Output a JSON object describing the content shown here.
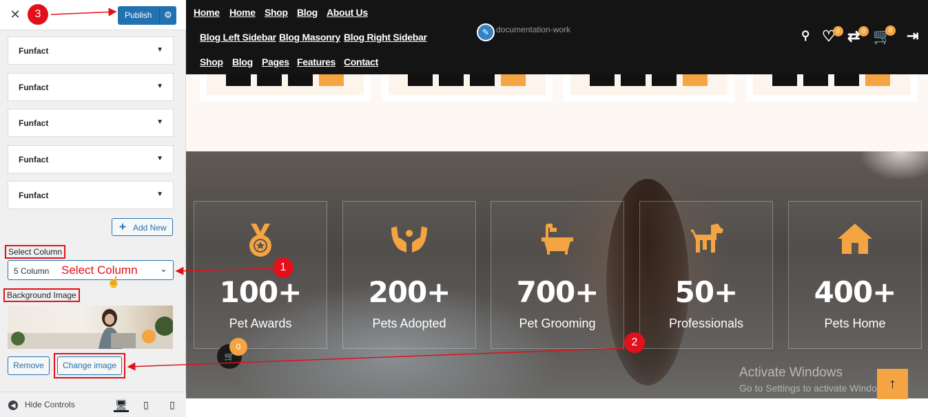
{
  "customizer": {
    "close_icon": "close-icon",
    "publish_label": "Publish",
    "funfacts": [
      "Funfact",
      "Funfact",
      "Funfact",
      "Funfact",
      "Funfact"
    ],
    "add_new_label": "Add New",
    "select_column_label": "Select Column",
    "select_column_value": "5 Column",
    "select_column_annotation": "Select Column",
    "background_image_label": "Background Image",
    "remove_label": "Remove",
    "change_image_label": "Change image",
    "hide_controls_label": "Hide Controls"
  },
  "annotations": {
    "step1": "1",
    "step2": "2",
    "step3": "3"
  },
  "header": {
    "nav_row1": [
      "Home",
      "Home",
      "Shop",
      "Blog",
      "About Us"
    ],
    "nav_row2": [
      "Blog Left Sidebar",
      "Blog Masonry",
      "Blog Right Sidebar"
    ],
    "nav_row3": [
      "Shop",
      "Blog",
      "Pages",
      "Features",
      "Contact"
    ],
    "logo_alt": "documentation-work",
    "wishlist_count": "0",
    "compare_count": "0",
    "cart_count": "0"
  },
  "stats": [
    {
      "number": "100+",
      "label": "Pet Awards",
      "icon": "medal-icon"
    },
    {
      "number": "200+",
      "label": "Pets Adopted",
      "icon": "caring-hands-icon"
    },
    {
      "number": "700+",
      "label": "Pet Grooming",
      "icon": "bathtub-icon"
    },
    {
      "number": "50+",
      "label": "Professionals",
      "icon": "dog-icon"
    },
    {
      "number": "400+",
      "label": "Pets Home",
      "icon": "home-icon"
    }
  ],
  "floating_cart_count": "0",
  "windows_watermark": {
    "title": "Activate Windows",
    "subtitle": "Go to Settings to activate Windows."
  },
  "colors": {
    "accent": "#f4a442",
    "wp_blue": "#2271b1",
    "annotation_red": "#e2101a",
    "nav_bg": "#141414"
  }
}
